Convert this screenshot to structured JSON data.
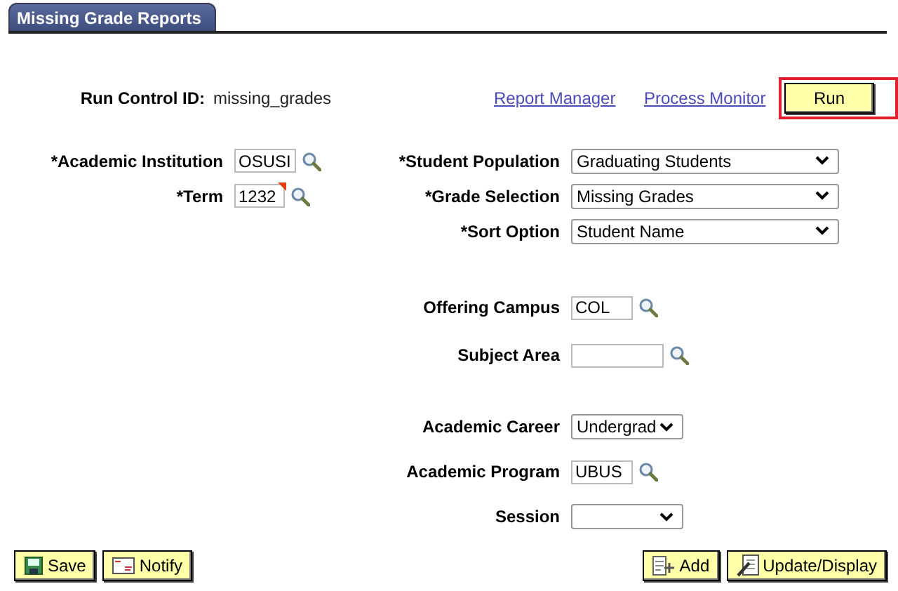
{
  "tab": {
    "label": "Missing Grade Reports",
    "selected": true
  },
  "run_control": {
    "label": "Run Control ID:",
    "value": "missing_grades"
  },
  "links": [
    "Report Manager",
    "Process Monitor"
  ],
  "run_button": {
    "label": "Run",
    "outlined": true
  },
  "sections": [
    [
      {
        "left": {
          "kind": "text",
          "label": "*Academic Institution",
          "value": "OSUSI",
          "modified": false
        },
        "right": {
          "kind": "select",
          "label": "*Student Population",
          "value": "Graduating Students"
        }
      },
      {
        "left": {
          "kind": "text",
          "label": "*Term",
          "value": "1232",
          "modified": true
        },
        "right": {
          "kind": "select",
          "label": "*Grade Selection",
          "value": "Missing Grades"
        }
      },
      {
        "right": {
          "kind": "select",
          "label": "*Sort Option",
          "value": "Student Name"
        }
      }
    ],
    [
      {
        "right": {
          "kind": "text",
          "label": "Offering Campus",
          "value": "COL",
          "modified": false
        }
      },
      {
        "right": {
          "kind": "text",
          "label": "Subject Area",
          "modified": false
        }
      }
    ],
    [
      {
        "right": {
          "kind": "select_short",
          "label": "Academic Career",
          "value": "Undergrad"
        }
      },
      {
        "right": {
          "kind": "text",
          "label": "Academic Program",
          "value": "UBUS",
          "modified": false
        }
      },
      {
        "right": {
          "kind": "select_short",
          "label": "Session"
        }
      }
    ]
  ],
  "footer_left": [
    {
      "kind": "save",
      "label": "Save"
    },
    {
      "kind": "notify",
      "label": "Notify"
    }
  ],
  "footer_right": [
    {
      "kind": "add",
      "label": "Add"
    },
    {
      "kind": "update",
      "label": "Update/Display"
    }
  ]
}
